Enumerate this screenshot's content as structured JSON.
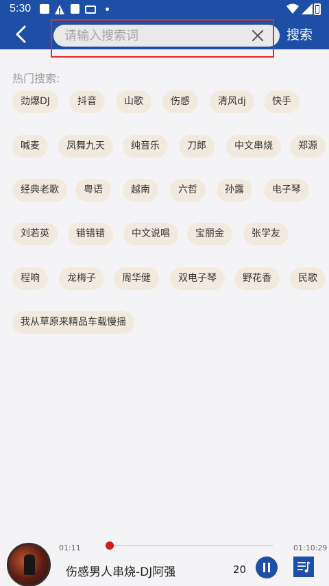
{
  "status_bar": {
    "time": "5:30"
  },
  "header": {
    "search_placeholder": "请输入搜索词",
    "search_button": "搜索"
  },
  "hot": {
    "title": "热门搜索:",
    "tags": [
      "劲爆DJ",
      "抖音",
      "山歌",
      "伤感",
      "清风dj",
      "快手",
      "喊麦",
      "凤舞九天",
      "纯音乐",
      "刀郎",
      "中文串烧",
      "郑源",
      "经典老歌",
      "粤语",
      "越南",
      "六哲",
      "孙露",
      "电子琴",
      "刘若英",
      "错错错",
      "中文说唱",
      "宝丽金",
      "张学友",
      "程响",
      "龙梅子",
      "周华健",
      "双电子琴",
      "野花香",
      "民歌",
      "我从草原来精品车载慢摇"
    ]
  },
  "player": {
    "current_time": "01:11",
    "total_time": "01:10:29",
    "song_title": "伤感男人串烧-DJ阿强",
    "extra": "20",
    "progress": 0.0
  },
  "colors": {
    "brand": "#1c4fa5",
    "tag_bg": "#f3eadf",
    "highlight": "#e8262b",
    "progress": "#d51b1b"
  }
}
